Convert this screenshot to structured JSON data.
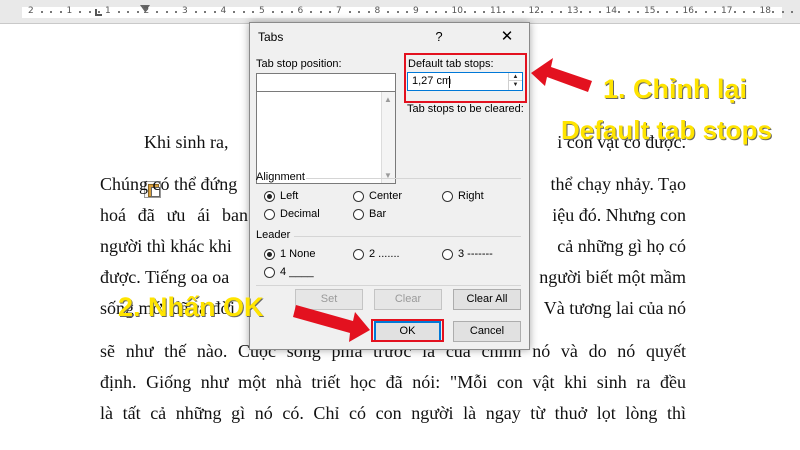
{
  "ruler": {
    "numbers": [
      "2",
      "1",
      "1",
      "2",
      "3",
      "4",
      "5",
      "6",
      "7",
      "8",
      "9",
      "10",
      "11",
      "12",
      "13",
      "14",
      "15",
      "16",
      "17",
      "18"
    ]
  },
  "document": {
    "lines": [
      "Khi sinh ra,",
      "i con vật có được.",
      "Chúng có thể đứng",
      "thể chạy nhảy. Tạo",
      "hoá đã ưu ái ban",
      "iệu đó. Nhưng con",
      "người thì khác khi",
      "cả những gì họ có",
      "được. Tiếng oa oa",
      "người biết một mầm",
      "sống mới đã ra đời",
      "Và tương lai của nó",
      "sẽ như thế nào. Cuộc sống phía trước là của chính nó và do nó quyết",
      "định. Giống như một nhà triết học đã nói: \"Mỗi con vật khi sinh ra đều",
      "là tất cả những gì nó có. Chỉ có con người là ngay từ thuở lọt lòng thì"
    ]
  },
  "dialog": {
    "title": "Tabs",
    "help_icon": "?",
    "close_icon": "✕",
    "tab_stop_position_label": "Tab stop position:",
    "tab_stop_position_value": "",
    "default_tab_stops_label": "Default tab stops:",
    "default_tab_stops_value": "1,27 cm",
    "tab_stops_to_clear_label": "Tab stops to be cleared:",
    "alignment": {
      "heading": "Alignment",
      "options": [
        "Left",
        "Center",
        "Right",
        "Decimal",
        "Bar"
      ],
      "selected": "Left"
    },
    "leader": {
      "heading": "Leader",
      "options": [
        "1 None",
        "2 .......",
        "3 -------",
        "4 ____"
      ],
      "selected": "1 None"
    },
    "buttons": {
      "set": "Set",
      "clear": "Clear",
      "clear_all": "Clear All",
      "ok": "OK",
      "cancel": "Cancel"
    }
  },
  "annotations": {
    "step1_line1": "1. Chỉnh lại",
    "step1_line2": "Default tab stops",
    "step2": "2. Nhấn OK"
  },
  "colors": {
    "highlight_red": "#e3111f",
    "annotation_yellow": "#ffe400"
  }
}
